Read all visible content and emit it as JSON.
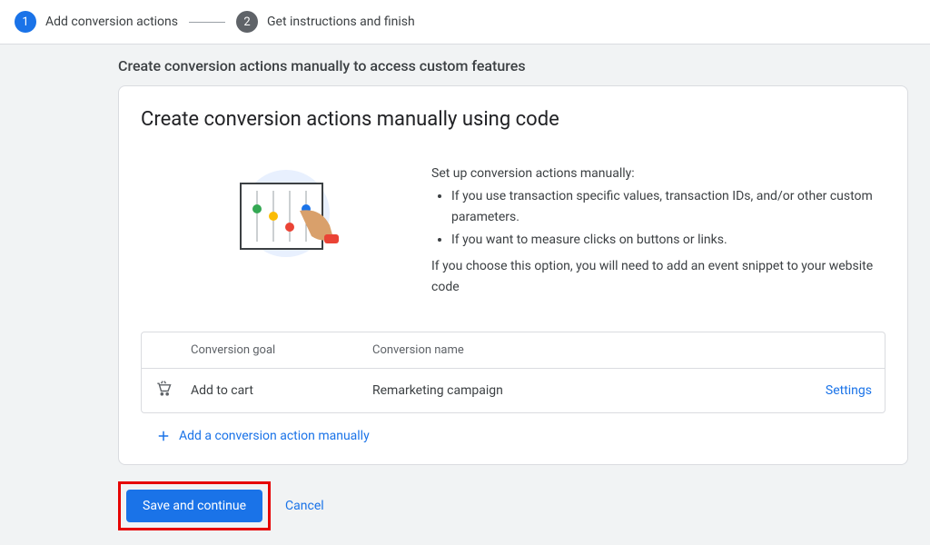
{
  "stepper": {
    "step1": {
      "num": "1",
      "label": "Add conversion actions"
    },
    "step2": {
      "num": "2",
      "label": "Get instructions and finish"
    }
  },
  "subtitle": "Create conversion actions manually to access custom features",
  "card": {
    "title": "Create conversion actions manually using code",
    "intro": "Set up conversion actions manually:",
    "bullet1": "If you use transaction specific values, transaction IDs, and/or other custom parameters.",
    "bullet2": "If you want to measure clicks on buttons or links.",
    "note": "If you choose this option, you will need to add an event snippet to your website code"
  },
  "table": {
    "h1": "Conversion goal",
    "h2": "Conversion name",
    "row": {
      "goal": "Add to cart",
      "name": "Remarketing campaign",
      "settings": "Settings"
    }
  },
  "add_action": "Add a conversion action manually",
  "footer": {
    "save": "Save and continue",
    "cancel": "Cancel"
  }
}
